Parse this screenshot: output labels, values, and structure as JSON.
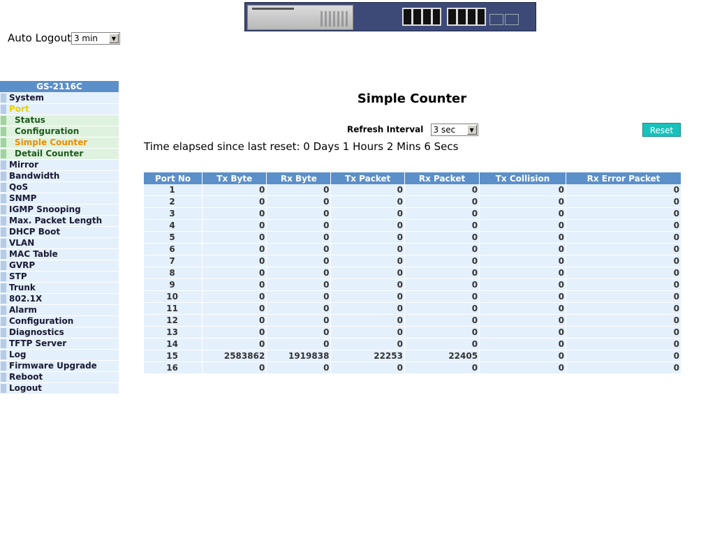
{
  "header": {
    "device_image": "switch-front-panel"
  },
  "auto_logout": {
    "label": "Auto Logout",
    "value": "3 min"
  },
  "sidebar": {
    "brand": "GS-2116C",
    "items": [
      {
        "label": "System",
        "type": "main"
      },
      {
        "label": "Port",
        "type": "main",
        "active": true
      },
      {
        "label": "Status",
        "type": "sub"
      },
      {
        "label": "Configuration",
        "type": "sub"
      },
      {
        "label": "Simple Counter",
        "type": "sub",
        "current": true
      },
      {
        "label": "Detail Counter",
        "type": "sub"
      },
      {
        "label": "Mirror",
        "type": "main"
      },
      {
        "label": "Bandwidth",
        "type": "main"
      },
      {
        "label": "QoS",
        "type": "main"
      },
      {
        "label": "SNMP",
        "type": "main"
      },
      {
        "label": "IGMP Snooping",
        "type": "main"
      },
      {
        "label": "Max. Packet Length",
        "type": "main"
      },
      {
        "label": "DHCP Boot",
        "type": "main"
      },
      {
        "label": "VLAN",
        "type": "main"
      },
      {
        "label": "MAC Table",
        "type": "main"
      },
      {
        "label": "GVRP",
        "type": "main"
      },
      {
        "label": "STP",
        "type": "main"
      },
      {
        "label": "Trunk",
        "type": "main"
      },
      {
        "label": "802.1X",
        "type": "main"
      },
      {
        "label": "Alarm",
        "type": "main"
      },
      {
        "label": "Configuration",
        "type": "main"
      },
      {
        "label": "Diagnostics",
        "type": "main"
      },
      {
        "label": "TFTP Server",
        "type": "main"
      },
      {
        "label": "Log",
        "type": "main"
      },
      {
        "label": "Firmware Upgrade",
        "type": "main"
      },
      {
        "label": "Reboot",
        "type": "main"
      },
      {
        "label": "Logout",
        "type": "main"
      }
    ]
  },
  "main": {
    "title": "Simple Counter",
    "refresh_label": "Refresh Interval",
    "refresh_value": "3 sec",
    "reset_label": "Reset",
    "elapsed": "Time elapsed since last reset: 0 Days 1 Hours 2 Mins 6 Secs",
    "table": {
      "columns": [
        "Port No",
        "Tx Byte",
        "Rx Byte",
        "Tx Packet",
        "Rx Packet",
        "Tx Collision",
        "Rx Error Packet"
      ],
      "rows": [
        [
          "1",
          "0",
          "0",
          "0",
          "0",
          "0",
          "0"
        ],
        [
          "2",
          "0",
          "0",
          "0",
          "0",
          "0",
          "0"
        ],
        [
          "3",
          "0",
          "0",
          "0",
          "0",
          "0",
          "0"
        ],
        [
          "4",
          "0",
          "0",
          "0",
          "0",
          "0",
          "0"
        ],
        [
          "5",
          "0",
          "0",
          "0",
          "0",
          "0",
          "0"
        ],
        [
          "6",
          "0",
          "0",
          "0",
          "0",
          "0",
          "0"
        ],
        [
          "7",
          "0",
          "0",
          "0",
          "0",
          "0",
          "0"
        ],
        [
          "8",
          "0",
          "0",
          "0",
          "0",
          "0",
          "0"
        ],
        [
          "9",
          "0",
          "0",
          "0",
          "0",
          "0",
          "0"
        ],
        [
          "10",
          "0",
          "0",
          "0",
          "0",
          "0",
          "0"
        ],
        [
          "11",
          "0",
          "0",
          "0",
          "0",
          "0",
          "0"
        ],
        [
          "12",
          "0",
          "0",
          "0",
          "0",
          "0",
          "0"
        ],
        [
          "13",
          "0",
          "0",
          "0",
          "0",
          "0",
          "0"
        ],
        [
          "14",
          "0",
          "0",
          "0",
          "0",
          "0",
          "0"
        ],
        [
          "15",
          "2583862",
          "1919838",
          "22253",
          "22405",
          "0",
          "0"
        ],
        [
          "16",
          "0",
          "0",
          "0",
          "0",
          "0",
          "0"
        ]
      ]
    }
  },
  "colors": {
    "header_blue": "#5b8fc9",
    "row_bg": "#e4f0fb",
    "sub_bg": "#dff2df",
    "active_text": "#e8d000",
    "current_text": "#f08c00",
    "reset_button": "#17c2bc"
  }
}
